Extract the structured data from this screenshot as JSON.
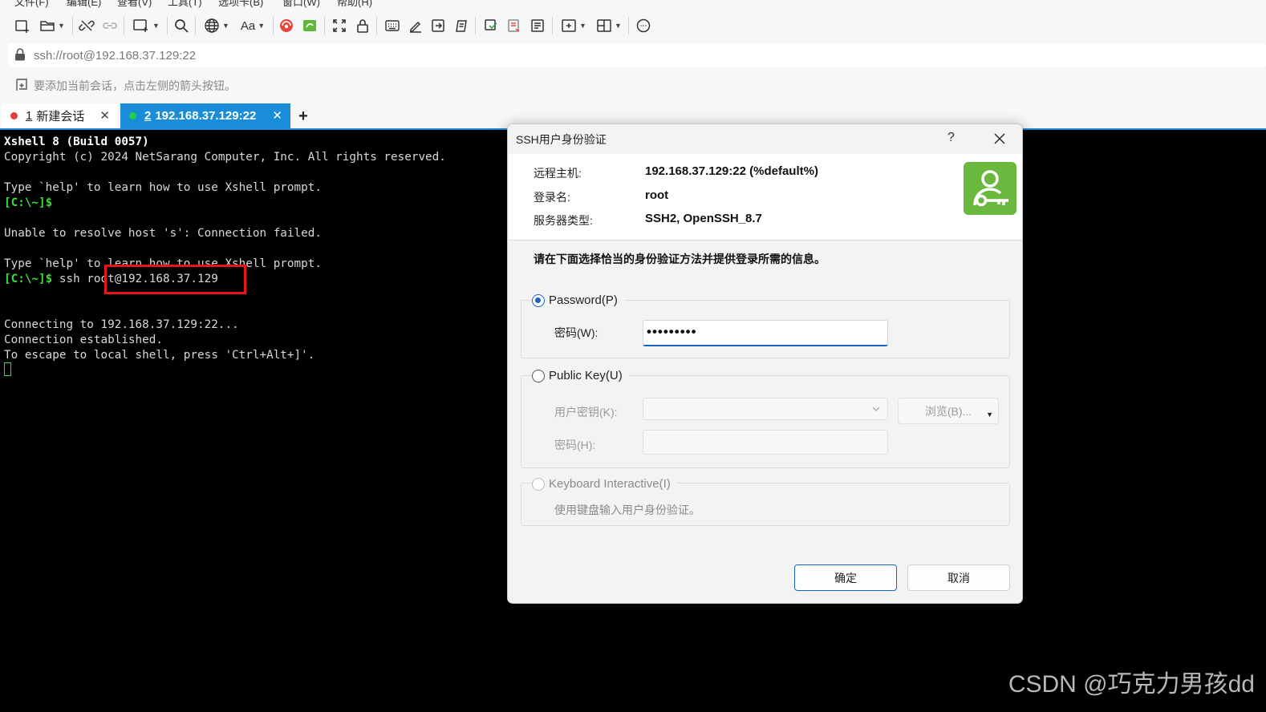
{
  "menubar": {
    "items": [
      "文件(F)",
      "编辑(E)",
      "查看(V)",
      "工具(T)",
      "选项卡(B)",
      "窗口(W)",
      "帮助(H)"
    ]
  },
  "toolbar": {
    "icons": [
      "new-session-icon",
      "open-folder-icon",
      "disconnect-icon",
      "link-icon",
      "new-window-icon",
      "search-icon",
      "globe-icon",
      "font-icon",
      "xshell-icon",
      "xftp-icon",
      "fullscreen-icon",
      "lock-icon",
      "keyboard-icon",
      "compose-icon",
      "send-icon",
      "script-icon",
      "transfer-icon",
      "log-icon",
      "notes-icon",
      "add-tab-icon",
      "layout-icon",
      "chat-icon"
    ],
    "font_label": "Aa"
  },
  "address": {
    "url": "ssh://root@192.168.37.129:22"
  },
  "hint": {
    "text": "要添加当前会话，点击左侧的箭头按钮。"
  },
  "tabs": [
    {
      "number": "1",
      "label": "新建会话",
      "status": "disconnected"
    },
    {
      "number": "2",
      "label": "192.168.37.129:22",
      "status": "connected",
      "active": true
    }
  ],
  "tab_add_label": "+",
  "terminal": {
    "line1": "Xshell 8 (Build 0057)",
    "line2": "Copyright (c) 2024 NetSarang Computer, Inc. All rights reserved.",
    "line3": "Type `help' to learn how to use Xshell prompt.",
    "prompt": "[C:\\~]$",
    "line5": "Unable to resolve host 's': Connection failed.",
    "line6": "Type `help' to learn how to use Xshell prompt.",
    "command": " ssh root@192.168.37.129",
    "line8": "Connecting to 192.168.37.129:22...",
    "line9": "Connection established.",
    "line10": "To escape to local shell, press 'Ctrl+Alt+]'."
  },
  "dialog": {
    "title": "SSH用户身份验证",
    "help": "?",
    "info": {
      "host_label": "远程主机:",
      "host_value": "192.168.37.129:22 (%default%)",
      "login_label": "登录名:",
      "login_value": "root",
      "server_label": "服务器类型:",
      "server_value": "SSH2, OpenSSH_8.7"
    },
    "instruction": "请在下面选择恰当的身份验证方法并提供登录所需的信息。",
    "password_option": "Password(P)",
    "password_label": "密码(W):",
    "password_value": "•••••••••",
    "pubkey_option": "Public Key(U)",
    "user_key_label": "用户密钥(K):",
    "browse_label": "浏览(B)...",
    "passphrase_label": "密码(H):",
    "keyboard_option": "Keyboard Interactive(I)",
    "keyboard_desc": "使用键盘输入用户身份验证。",
    "ok_label": "确定",
    "cancel_label": "取消"
  },
  "watermark": "CSDN @巧克力男孩dd"
}
